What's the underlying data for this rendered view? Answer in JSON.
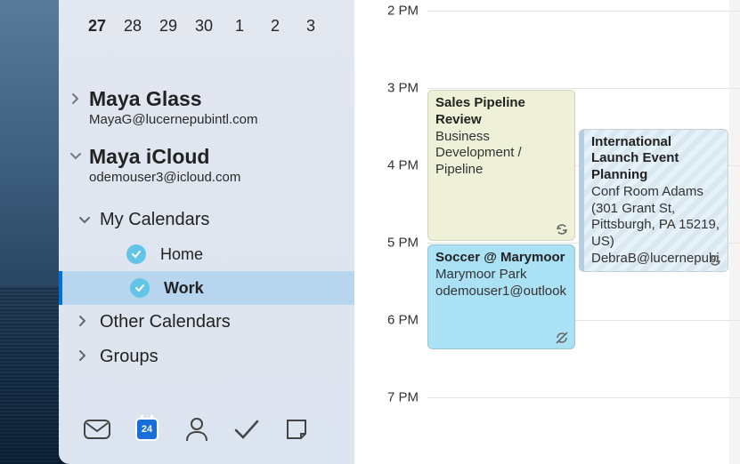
{
  "miniCalendar": {
    "days": [
      "27",
      "28",
      "29",
      "30",
      "1",
      "2",
      "3"
    ],
    "selectedIndex": 0
  },
  "accounts": [
    {
      "name": "Maya Glass",
      "email": "MayaG@lucernepubintl.com",
      "expanded": false
    },
    {
      "name": "Maya iCloud",
      "email": "odemouser3@icloud.com",
      "expanded": true
    }
  ],
  "sections": {
    "myCalendars": {
      "label": "My Calendars",
      "expanded": true,
      "items": [
        {
          "label": "Home",
          "checked": true,
          "selected": false,
          "color": "#63c4e8"
        },
        {
          "label": "Work",
          "checked": true,
          "selected": true,
          "color": "#63c4e8"
        }
      ]
    },
    "otherCalendars": {
      "label": "Other Calendars",
      "expanded": false
    },
    "groups": {
      "label": "Groups",
      "expanded": false
    }
  },
  "bottomNav": {
    "calendarDayNumber": "24",
    "activeIndex": 1
  },
  "timeAxis": {
    "hours": [
      "2 PM",
      "3 PM",
      "4 PM",
      "5 PM",
      "6 PM",
      "7 PM"
    ],
    "startHour": 14,
    "pxPerHour": 87,
    "topOffset": 12
  },
  "events": [
    {
      "id": "sales",
      "title": "Sales Pipeline Review",
      "sub1": "Business Development / Pipeline",
      "organizer": "",
      "color": "green",
      "startHour": 15,
      "endHour": 17,
      "col": 0,
      "hasSync": true
    },
    {
      "id": "soccer",
      "title": "Soccer @ Marymoor",
      "sub1": "Marymoor Park",
      "organizer": "odemouser1@outlook",
      "color": "blue",
      "startHour": 17,
      "endHour": 18.4,
      "col": 0,
      "hasSync": false,
      "hasBusy": true
    },
    {
      "id": "launch",
      "title": "International Launch Event Planning",
      "sub1": "Conf Room Adams (301 Grant St, Pittsburgh, PA 15219, US)",
      "organizer": "DebraB@lucernepubi",
      "color": "ltblue",
      "startHour": 15.5,
      "endHour": 17.4,
      "col": 1,
      "hasSync": true
    }
  ]
}
